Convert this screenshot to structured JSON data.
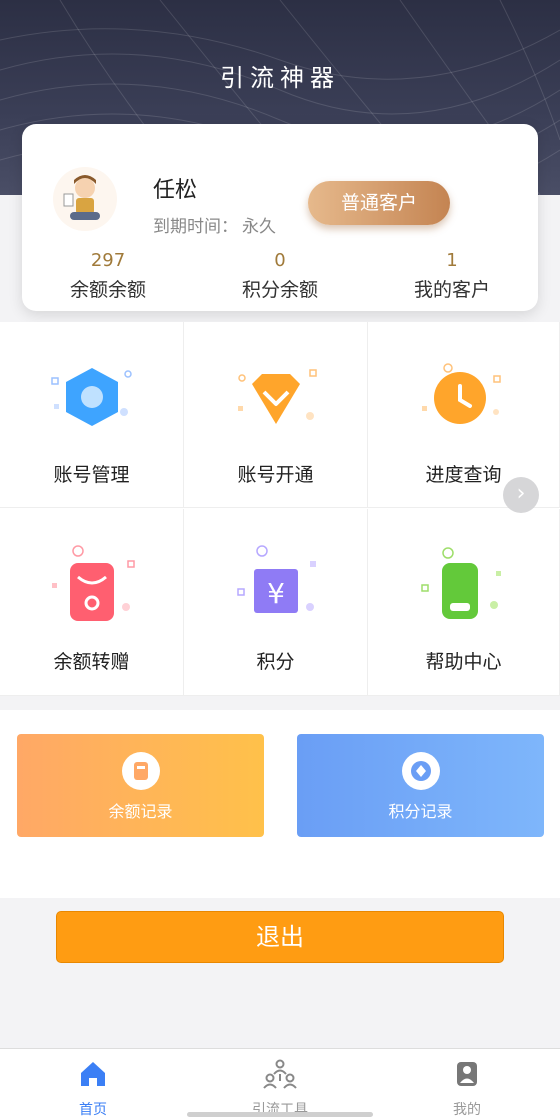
{
  "header": {
    "title": "引流神器"
  },
  "profile": {
    "name": "任松",
    "expire_label": "到期时间：",
    "expire_value": "永久",
    "vip_label": "普通客户"
  },
  "stats": [
    {
      "value": "297",
      "label": "余额余额"
    },
    {
      "value": "0",
      "label": "积分余额"
    },
    {
      "value": "1",
      "label": "我的客户"
    }
  ],
  "menu": [
    {
      "label": "账号管理",
      "icon": "hexagon-icon"
    },
    {
      "label": "账号开通",
      "icon": "diamond-icon"
    },
    {
      "label": "进度查询",
      "icon": "clock-icon"
    },
    {
      "label": "余额转赠",
      "icon": "red-envelope-icon"
    },
    {
      "label": "积分",
      "icon": "yen-card-icon"
    },
    {
      "label": "帮助中心",
      "icon": "phone-icon"
    }
  ],
  "records": [
    {
      "label": "余额记录",
      "icon": "wallet-icon"
    },
    {
      "label": "积分记录",
      "icon": "coin-icon"
    }
  ],
  "logout_label": "退出",
  "tabs": [
    {
      "label": "首页",
      "icon": "home-icon",
      "active": true
    },
    {
      "label": "引流工具",
      "icon": "people-network-icon",
      "active": false
    },
    {
      "label": "我的",
      "icon": "user-icon",
      "active": false
    }
  ],
  "colors": {
    "accent": "#3b7ff5",
    "logout": "#ff9c12",
    "stat_number": "#a07a3a",
    "header_bg": "#2c2f44"
  }
}
